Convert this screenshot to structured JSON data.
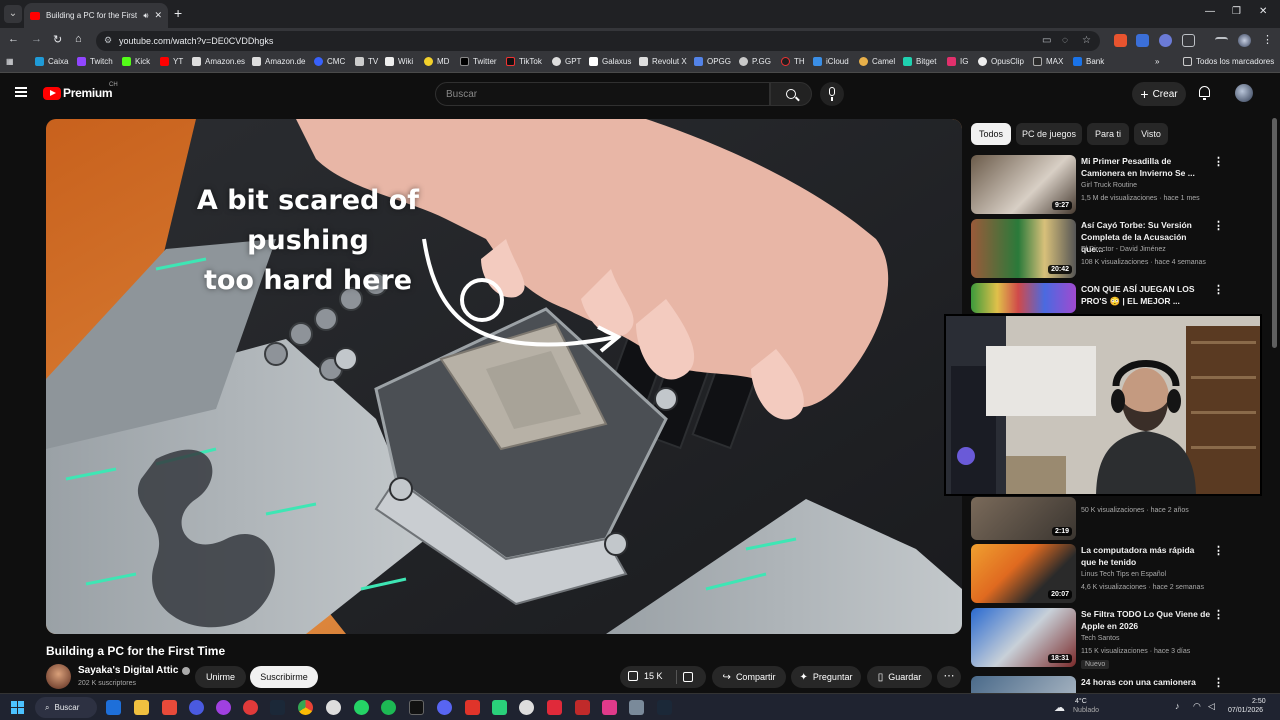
{
  "browser": {
    "tab_title": "Building a PC for the First T",
    "url": "youtube.com/watch?v=DE0CVDDhgks",
    "bookmarks": [
      "Caixa",
      "Twitch",
      "Kick",
      "YT",
      "Amazon.es",
      "Amazon.de",
      "CMC",
      "TV",
      "Wiki",
      "MD",
      "Twitter",
      "TikTok",
      "GPT",
      "Galaxus",
      "Revolut X",
      "OPGG",
      "P.GG",
      "TH",
      "iCloud",
      "Camel",
      "Bitget",
      "IG",
      "OpusClip",
      "MAX",
      "Bank"
    ],
    "all_bookmarks": "Todos los marcadores",
    "colors": {
      "frame": "#202124",
      "toolbar": "#35363a"
    }
  },
  "header": {
    "brand": "Premium",
    "country": "CH",
    "search_placeholder": "Buscar",
    "create_label": "Crear"
  },
  "video": {
    "caption_line1": "A bit scared of pushing",
    "caption_line2": "too hard here",
    "title": "Building a PC for the First Time",
    "channel": "Sayaka's Digital Attic",
    "subscribers": "202 K suscriptores",
    "join_label": "Unirme",
    "subscribe_label": "Suscribirme",
    "likes": "15 K",
    "share_label": "Compartir",
    "ask_label": "Preguntar",
    "save_label": "Guardar"
  },
  "chips": [
    "Todos",
    "PC de juegos",
    "Para ti",
    "Visto"
  ],
  "recommendations": [
    {
      "title": "Mi Primer Pesadilla de Camionera en Invierno Se ...",
      "channel": "Girl Truck Routine",
      "meta": "1,5 M de visualizaciones · hace 1 mes",
      "duration": "9:27"
    },
    {
      "title": "Así Cayó Torbe: Su Versión Completa de la Acusación que...",
      "channel": "El Director - David Jiménez",
      "meta": "108 K visualizaciones · hace 4 semanas",
      "duration": "20:42"
    },
    {
      "title": "CON QUE ASÍ JUEGAN LOS PRO'S 😳 | EL MEJOR ...",
      "channel": "",
      "meta": "",
      "duration": ""
    },
    {
      "title": "",
      "channel": "",
      "meta": "50 K visualizaciones · hace 2 años",
      "duration": "2:19"
    },
    {
      "title": "La computadora más rápida que he tenido",
      "channel": "Linus Tech Tips en Español",
      "meta": "4,6 K visualizaciones · hace 2 semanas",
      "duration": "20:07"
    },
    {
      "title": "Se Filtra TODO Lo Que Viene de Apple en 2026",
      "channel": "Tech Santos",
      "meta": "115 K visualizaciones · hace 3 días",
      "duration": "18:31",
      "badge": "Nuevo"
    },
    {
      "title": "24 horas con una camionera",
      "channel": "",
      "meta": "",
      "duration": ""
    }
  ],
  "taskbar": {
    "search_label": "Buscar",
    "temperature": "4°C",
    "weather": "Nublado",
    "time": "2:50",
    "date": "07/01/2026"
  }
}
